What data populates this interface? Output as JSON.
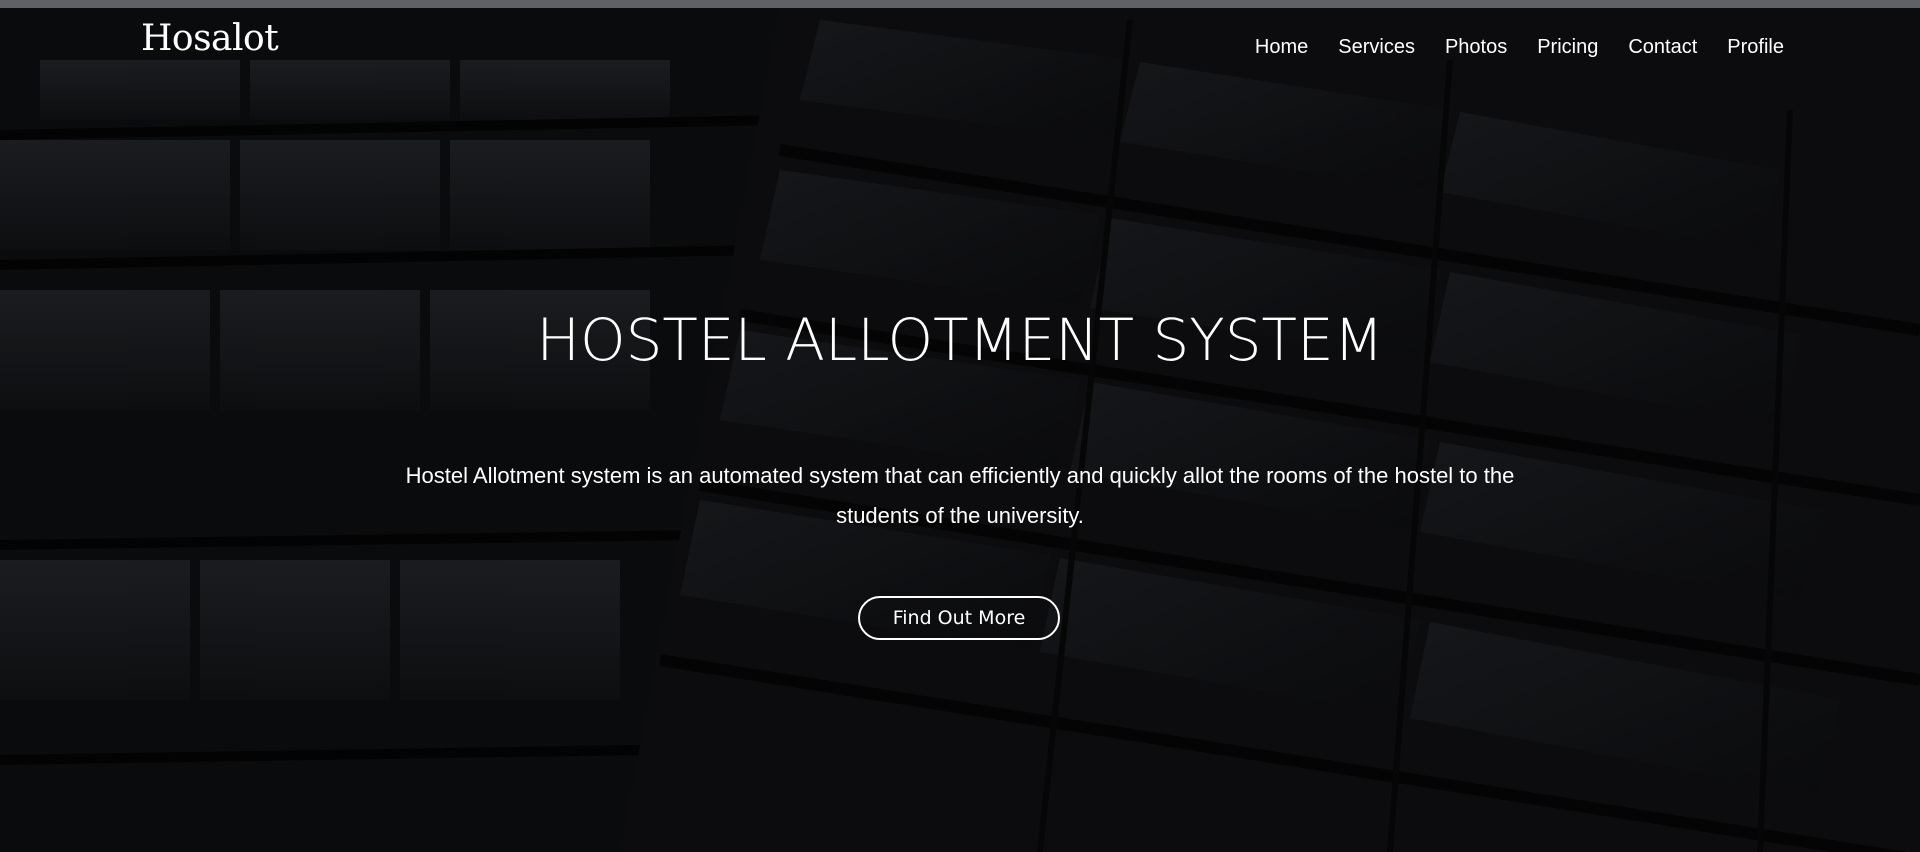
{
  "brand": {
    "name": "Hosalot"
  },
  "nav": {
    "items": [
      {
        "label": "Home"
      },
      {
        "label": "Services"
      },
      {
        "label": "Photos"
      },
      {
        "label": "Pricing"
      },
      {
        "label": "Contact"
      },
      {
        "label": "Profile"
      }
    ]
  },
  "hero": {
    "title": "HOSTEL ALLOTMENT SYSTEM",
    "description": "Hostel Allotment system is an automated system that can efficiently and quickly allot the rooms of the hostel to the students of the university.",
    "cta_label": "Find Out More"
  },
  "colors": {
    "text": "#ffffff",
    "background": "#0b0b0d",
    "top_border": "#5f6166"
  }
}
